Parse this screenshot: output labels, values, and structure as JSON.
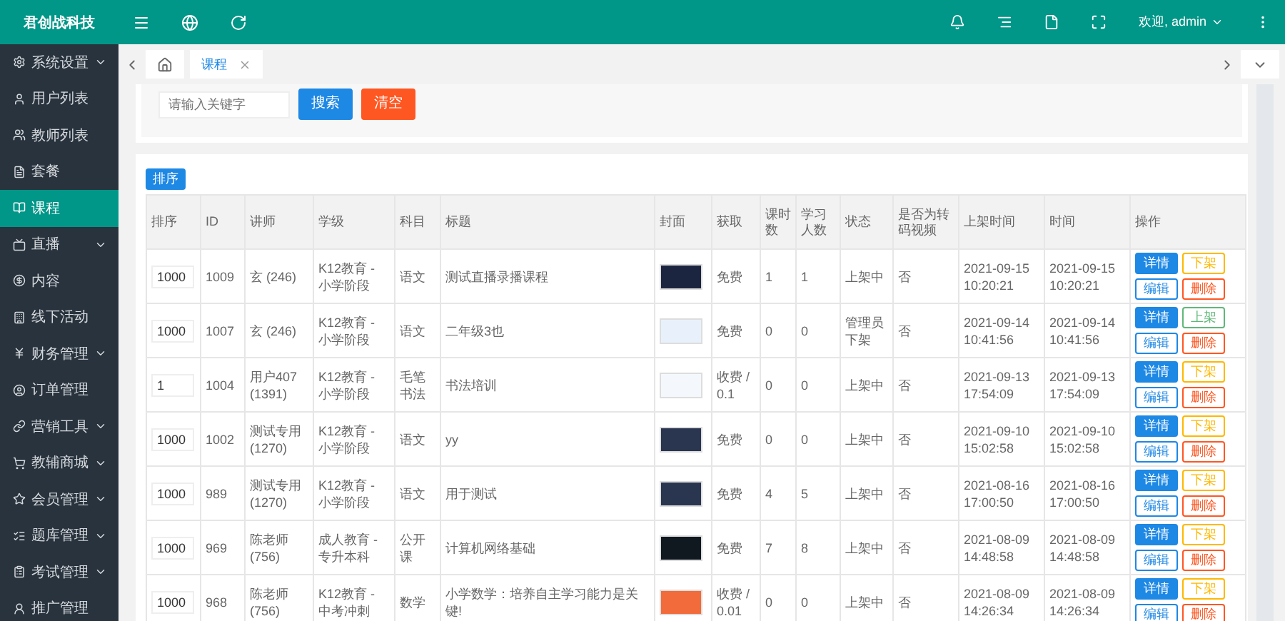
{
  "brand": "君创战科技",
  "sidebar": {
    "items": [
      {
        "label": "系统设置",
        "selected": false,
        "expandable": true
      },
      {
        "label": "用户列表",
        "selected": false,
        "expandable": false
      },
      {
        "label": "教师列表",
        "selected": false,
        "expandable": false
      },
      {
        "label": "套餐",
        "selected": false,
        "expandable": false
      },
      {
        "label": "课程",
        "selected": true,
        "expandable": false
      },
      {
        "label": "直播",
        "selected": false,
        "expandable": true
      },
      {
        "label": "内容",
        "selected": false,
        "expandable": false
      },
      {
        "label": "线下活动",
        "selected": false,
        "expandable": false
      },
      {
        "label": "财务管理",
        "selected": false,
        "expandable": true
      },
      {
        "label": "订单管理",
        "selected": false,
        "expandable": false
      },
      {
        "label": "营销工具",
        "selected": false,
        "expandable": true
      },
      {
        "label": "教辅商城",
        "selected": false,
        "expandable": true
      },
      {
        "label": "会员管理",
        "selected": false,
        "expandable": true
      },
      {
        "label": "题库管理",
        "selected": false,
        "expandable": true
      },
      {
        "label": "考试管理",
        "selected": false,
        "expandable": true
      },
      {
        "label": "推广管理",
        "selected": false,
        "expandable": false
      }
    ]
  },
  "header": {
    "user": "欢迎, admin"
  },
  "tabs": [
    {
      "label": "课程",
      "selected": true
    }
  ],
  "search": {
    "placeholder": "请输入关键字",
    "buttons": [
      {
        "label": "搜索",
        "kind": "primary"
      },
      {
        "label": "清空",
        "kind": "danger"
      }
    ]
  },
  "sort_button": "排序",
  "table": {
    "columns": [
      "排序",
      "ID",
      "讲师",
      "学级",
      "科目",
      "标题",
      "封面",
      "获取",
      "课时数",
      "学习人数",
      "状态",
      "是否为转码视频",
      "上架时间",
      "时间",
      "操作"
    ],
    "rows": [
      {
        "sort": "1000",
        "id": "1009",
        "teacher": "玄 (246)",
        "level": "K12教育 - 小学阶段",
        "subject": "语文",
        "title": "测试直播录播课程",
        "cover": {
          "color": "#1c2540"
        },
        "access": "免费",
        "lessons": "1",
        "learners": "1",
        "status": "上架中",
        "transcoded": "否",
        "listed_time": "2021-09-15 10:20:21",
        "time": "2021-09-15 10:20:21",
        "actions": [
          {
            "label": "详情",
            "kind": "primary"
          },
          {
            "label": "下架",
            "kind": "warn"
          },
          {
            "label": "编辑",
            "kind": "edit"
          },
          {
            "label": "删除",
            "kind": "danger"
          }
        ]
      },
      {
        "sort": "1000",
        "id": "1007",
        "teacher": "玄 (246)",
        "level": "K12教育 - 小学阶段",
        "subject": "语文",
        "title": "二年级3也",
        "cover": {
          "color": "#e8f1fb"
        },
        "access": "免费",
        "lessons": "0",
        "learners": "0",
        "status": "管理员下架",
        "transcoded": "否",
        "listed_time": "2021-09-14 10:41:56",
        "time": "2021-09-14 10:41:56",
        "actions": [
          {
            "label": "详情",
            "kind": "primary"
          },
          {
            "label": "上架",
            "kind": "ok"
          },
          {
            "label": "编辑",
            "kind": "edit"
          },
          {
            "label": "删除",
            "kind": "danger"
          }
        ]
      },
      {
        "sort": "1",
        "id": "1004",
        "teacher": "用户407 (1391)",
        "level": "K12教育 - 小学阶段",
        "subject": "毛笔书法",
        "title": "书法培训",
        "cover": {
          "color": "#f4f8fc"
        },
        "access": "收费 / 0.1",
        "lessons": "0",
        "learners": "0",
        "status": "上架中",
        "transcoded": "否",
        "listed_time": "2021-09-13 17:54:09",
        "time": "2021-09-13 17:54:09",
        "actions": [
          {
            "label": "详情",
            "kind": "primary"
          },
          {
            "label": "下架",
            "kind": "warn"
          },
          {
            "label": "编辑",
            "kind": "edit"
          },
          {
            "label": "删除",
            "kind": "danger"
          }
        ]
      },
      {
        "sort": "1000",
        "id": "1002",
        "teacher": "测试专用 (1270)",
        "level": "K12教育 - 小学阶段",
        "subject": "语文",
        "title": "yy",
        "cover": {
          "color": "#2a3550"
        },
        "access": "免费",
        "lessons": "0",
        "learners": "0",
        "status": "上架中",
        "transcoded": "否",
        "listed_time": "2021-09-10 15:02:58",
        "time": "2021-09-10 15:02:58",
        "actions": [
          {
            "label": "详情",
            "kind": "primary"
          },
          {
            "label": "下架",
            "kind": "warn"
          },
          {
            "label": "编辑",
            "kind": "edit"
          },
          {
            "label": "删除",
            "kind": "danger"
          }
        ]
      },
      {
        "sort": "1000",
        "id": "989",
        "teacher": "测试专用 (1270)",
        "level": "K12教育 - 小学阶段",
        "subject": "语文",
        "title": "用于测试",
        "cover": {
          "color": "#2a3550"
        },
        "access": "免费",
        "lessons": "4",
        "learners": "5",
        "status": "上架中",
        "transcoded": "否",
        "listed_time": "2021-08-16 17:00:50",
        "time": "2021-08-16 17:00:50",
        "actions": [
          {
            "label": "详情",
            "kind": "primary"
          },
          {
            "label": "下架",
            "kind": "warn"
          },
          {
            "label": "编辑",
            "kind": "edit"
          },
          {
            "label": "删除",
            "kind": "danger"
          }
        ]
      },
      {
        "sort": "1000",
        "id": "969",
        "teacher": "陈老师 (756)",
        "level": "成人教育 - 专升本科",
        "subject": "公开课",
        "title": "计算机网络基础",
        "cover": {
          "color": "#101820"
        },
        "access": "免费",
        "lessons": "7",
        "learners": "8",
        "status": "上架中",
        "transcoded": "否",
        "listed_time": "2021-08-09 14:48:58",
        "time": "2021-08-09 14:48:58",
        "actions": [
          {
            "label": "详情",
            "kind": "primary"
          },
          {
            "label": "下架",
            "kind": "warn"
          },
          {
            "label": "编辑",
            "kind": "edit"
          },
          {
            "label": "删除",
            "kind": "danger"
          }
        ]
      },
      {
        "sort": "1000",
        "id": "968",
        "teacher": "陈老师 (756)",
        "level": "K12教育 - 中考冲刺",
        "subject": "数学",
        "title": "小学数学：培养自主学习能力是关键!",
        "cover": {
          "color": "#f26b3a"
        },
        "access": "收费 / 0.01",
        "lessons": "0",
        "learners": "0",
        "status": "上架中",
        "transcoded": "否",
        "listed_time": "2021-08-09 14:26:34",
        "time": "2021-08-09 14:26:34",
        "actions": [
          {
            "label": "详情",
            "kind": "primary"
          },
          {
            "label": "下架",
            "kind": "warn"
          },
          {
            "label": "编辑",
            "kind": "edit"
          },
          {
            "label": "删除",
            "kind": "danger"
          }
        ]
      }
    ]
  }
}
